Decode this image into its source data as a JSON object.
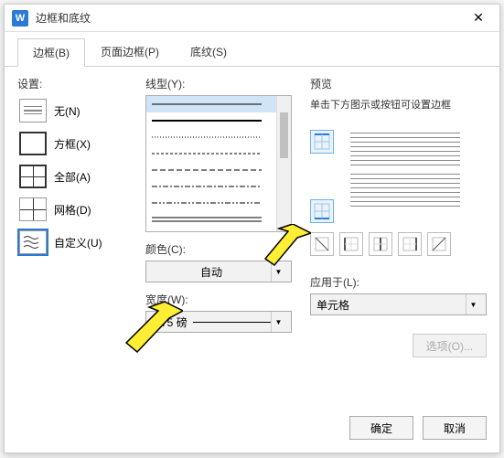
{
  "window": {
    "title": "边框和底纹"
  },
  "tabs": [
    {
      "label": "边框(B)",
      "active": true
    },
    {
      "label": "页面边框(P)",
      "active": false
    },
    {
      "label": "底纹(S)",
      "active": false
    }
  ],
  "settings": {
    "label": "设置:",
    "items": [
      {
        "name": "none",
        "label": "无(N)",
        "icon": "none"
      },
      {
        "name": "box",
        "label": "方框(X)",
        "icon": "box"
      },
      {
        "name": "all",
        "label": "全部(A)",
        "icon": "all"
      },
      {
        "name": "grid",
        "label": "网格(D)",
        "icon": "grid"
      },
      {
        "name": "custom",
        "label": "自定义(U)",
        "icon": "custom",
        "selected": true
      }
    ]
  },
  "linestyle": {
    "label": "线型(Y):"
  },
  "color": {
    "label": "颜色(C):",
    "value": "自动"
  },
  "width": {
    "label": "宽度(W):",
    "value": "0.75 磅"
  },
  "preview": {
    "label": "预览",
    "hint": "单击下方图示或按钮可设置边框"
  },
  "applyto": {
    "label": "应用于(L):",
    "value": "单元格"
  },
  "buttons": {
    "options": "选项(O)...",
    "ok": "确定",
    "cancel": "取消"
  }
}
